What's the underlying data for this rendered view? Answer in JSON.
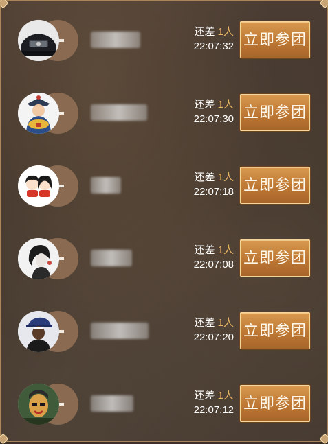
{
  "colors": {
    "accent_number": "#e7b464",
    "button": "#c07a35",
    "frame_border": "#a8865c"
  },
  "rows": [
    {
      "need_prefix": "还差",
      "need_count": "1人",
      "time": "22:07:32",
      "button_label": "立即参团",
      "avatar": "car-avatar"
    },
    {
      "need_prefix": "还差",
      "need_count": "1人",
      "time": "22:07:30",
      "button_label": "立即参团",
      "avatar": "emperor-avatar"
    },
    {
      "need_prefix": "还差",
      "need_count": "1人",
      "time": "22:07:18",
      "button_label": "立即参团",
      "avatar": "cartoon-couple-avatar"
    },
    {
      "need_prefix": "还差",
      "need_count": "1人",
      "time": "22:07:08",
      "button_label": "立即参团",
      "avatar": "sketch-girl-avatar"
    },
    {
      "need_prefix": "还差",
      "need_count": "1人",
      "time": "22:07:20",
      "button_label": "立即参团",
      "avatar": "man-hat-avatar"
    },
    {
      "need_prefix": "还差",
      "need_count": "1人",
      "time": "22:07:12",
      "button_label": "立即参团",
      "avatar": "painted-face-avatar"
    }
  ]
}
